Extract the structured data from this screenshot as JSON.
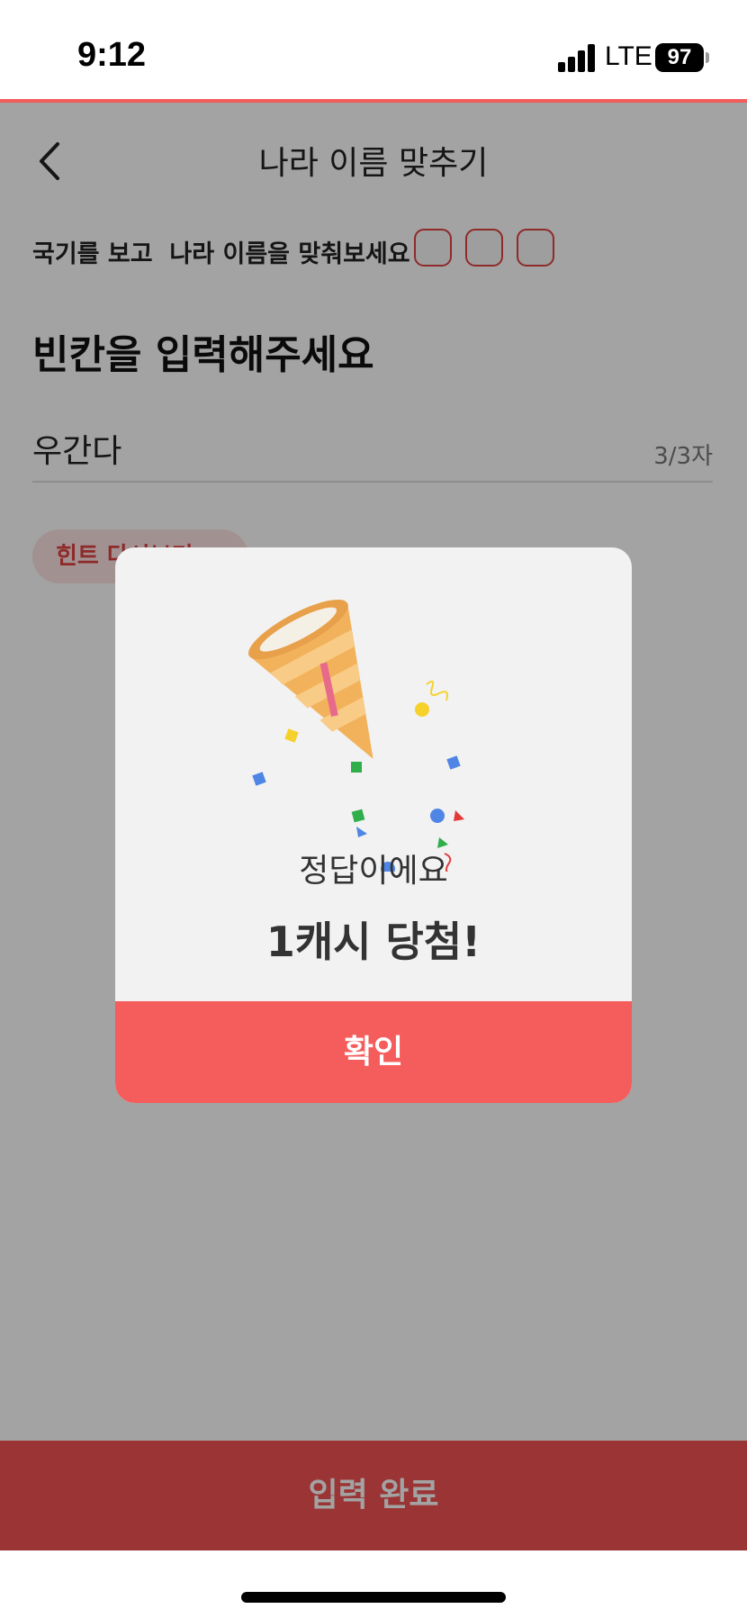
{
  "status_bar": {
    "time": "9:12",
    "network": "LTE",
    "battery": "97"
  },
  "nav": {
    "title": "나라 이름 맞추기"
  },
  "quiz": {
    "instruction": "국기를 보고  나라 이름을 맞춰보세요",
    "blank_count": 3,
    "heading": "빈칸을 입력해주세요",
    "answer_value": "우간다",
    "char_count": "3/3자",
    "hint_label": "힌트 다시보기"
  },
  "cta": {
    "label": "입력 완료"
  },
  "modal": {
    "message": "정답이에요",
    "prize": "1캐시 당첨!",
    "confirm_label": "확인"
  },
  "colors": {
    "accent": "#f25252",
    "confirm": "#f55c5c",
    "hint_bg": "#fde3e3",
    "hint_text": "#e04343",
    "modal_bg": "#f2f2f2"
  },
  "icons": {
    "back": "chevron-left-icon",
    "popper": "party-popper-icon",
    "hint_chevron": "chevron-right-icon",
    "signal": "cellular-signal-icon",
    "battery": "battery-icon"
  }
}
